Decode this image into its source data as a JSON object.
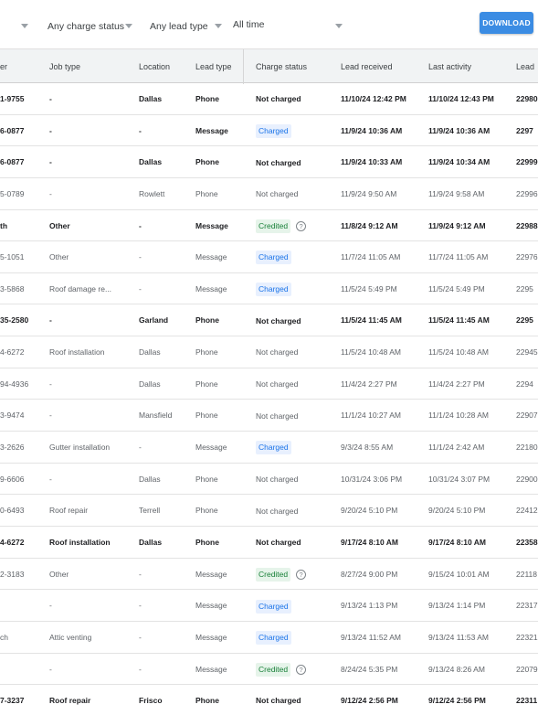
{
  "filters": {
    "charge_status": "Any charge status",
    "lead_type": "Any lead type",
    "time_range": "All time"
  },
  "download_label": "DOWNLOAD",
  "columns": [
    "er",
    "Job type",
    "Location",
    "Lead type",
    "Charge status",
    "Lead received",
    "Last activity",
    "Lead"
  ],
  "rows": [
    {
      "phone": "1-9755",
      "job": "-",
      "loc": "Dallas",
      "type": "Phone",
      "status": "Not charged",
      "received": "11/10/24 12:42 PM",
      "activity": "11/10/24 12:43 PM",
      "lead": "22980",
      "bold": true,
      "status_kind": "none"
    },
    {
      "phone": "6-0877",
      "job": "-",
      "loc": "-",
      "type": "Message",
      "status": "Charged",
      "received": "11/9/24 10:36 AM",
      "activity": "11/9/24 10:36 AM",
      "lead": "2297",
      "bold": true,
      "status_kind": "charged"
    },
    {
      "phone": "6-0877",
      "job": "-",
      "loc": "Dallas",
      "type": "Phone",
      "status": "Not charged",
      "received": "11/9/24 10:33 AM",
      "activity": "11/9/24 10:34 AM",
      "lead": "22999",
      "bold": true,
      "status_kind": "none"
    },
    {
      "phone": "5-0789",
      "job": "-",
      "loc": "Rowlett",
      "type": "Phone",
      "status": "Not charged",
      "received": "11/9/24 9:50 AM",
      "activity": "11/9/24 9:58 AM",
      "lead": "22996",
      "bold": false,
      "status_kind": "none"
    },
    {
      "phone": "th",
      "job": "Other",
      "loc": "-",
      "type": "Message",
      "status": "Credited",
      "received": "11/8/24 9:12 AM",
      "activity": "11/9/24 9:12 AM",
      "lead": "22988",
      "bold": true,
      "status_kind": "credited",
      "help": true
    },
    {
      "phone": "5-1051",
      "job": "Other",
      "loc": "-",
      "type": "Message",
      "status": "Charged",
      "received": "11/7/24 11:05 AM",
      "activity": "11/7/24 11:05 AM",
      "lead": "22976",
      "bold": false,
      "status_kind": "charged"
    },
    {
      "phone": "3-5868",
      "job": "Roof damage re...",
      "loc": "-",
      "type": "Message",
      "status": "Charged",
      "received": "11/5/24 5:49 PM",
      "activity": "11/5/24 5:49 PM",
      "lead": "2295",
      "bold": false,
      "status_kind": "charged"
    },
    {
      "phone": "35-2580",
      "job": "-",
      "loc": "Garland",
      "type": "Phone",
      "status": "Not charged",
      "received": "11/5/24 11:45 AM",
      "activity": "11/5/24 11:45 AM",
      "lead": "2295",
      "bold": true,
      "status_kind": "none"
    },
    {
      "phone": "4-6272",
      "job": "Roof installation",
      "loc": "Dallas",
      "type": "Phone",
      "status": "Not charged",
      "received": "11/5/24 10:48 AM",
      "activity": "11/5/24 10:48 AM",
      "lead": "22945",
      "bold": false,
      "status_kind": "none"
    },
    {
      "phone": "94-4936",
      "job": "-",
      "loc": "Dallas",
      "type": "Phone",
      "status": "Not charged",
      "received": "11/4/24 2:27 PM",
      "activity": "11/4/24 2:27 PM",
      "lead": "2294",
      "bold": false,
      "status_kind": "none"
    },
    {
      "phone": "3-9474",
      "job": "-",
      "loc": "Mansfield",
      "type": "Phone",
      "status": "Not charged",
      "received": "11/1/24 10:27 AM",
      "activity": "11/1/24 10:28 AM",
      "lead": "22907",
      "bold": false,
      "status_kind": "none"
    },
    {
      "phone": "3-2626",
      "job": "Gutter installation",
      "loc": "-",
      "type": "Message",
      "status": "Charged",
      "received": "9/3/24 8:55 AM",
      "activity": "11/1/24 2:42 AM",
      "lead": "22180",
      "bold": false,
      "status_kind": "charged"
    },
    {
      "phone": "9-6606",
      "job": "-",
      "loc": "Dallas",
      "type": "Phone",
      "status": "Not charged",
      "received": "10/31/24 3:06 PM",
      "activity": "10/31/24 3:07 PM",
      "lead": "22900",
      "bold": false,
      "status_kind": "none"
    },
    {
      "phone": "0-6493",
      "job": "Roof repair",
      "loc": "Terrell",
      "type": "Phone",
      "status": "Not charged",
      "received": "9/20/24 5:10 PM",
      "activity": "9/20/24 5:10 PM",
      "lead": "22412",
      "bold": false,
      "status_kind": "none"
    },
    {
      "phone": "4-6272",
      "job": "Roof installation",
      "loc": "Dallas",
      "type": "Phone",
      "status": "Not charged",
      "received": "9/17/24 8:10 AM",
      "activity": "9/17/24 8:10 AM",
      "lead": "22358",
      "bold": true,
      "status_kind": "none"
    },
    {
      "phone": "2-3183",
      "job": "Other",
      "loc": "-",
      "type": "Message",
      "status": "Credited",
      "received": "8/27/24 9:00 PM",
      "activity": "9/15/24 10:01 AM",
      "lead": "22118",
      "bold": false,
      "status_kind": "credited",
      "help": true
    },
    {
      "phone": "",
      "job": "-",
      "loc": "-",
      "type": "Message",
      "status": "Charged",
      "received": "9/13/24 1:13 PM",
      "activity": "9/13/24 1:14 PM",
      "lead": "22317",
      "bold": false,
      "status_kind": "charged"
    },
    {
      "phone": "ch",
      "job": "Attic venting",
      "loc": "-",
      "type": "Message",
      "status": "Charged",
      "received": "9/13/24 11:52 AM",
      "activity": "9/13/24 11:53 AM",
      "lead": "22321",
      "bold": false,
      "status_kind": "charged"
    },
    {
      "phone": "",
      "job": "-",
      "loc": "-",
      "type": "Message",
      "status": "Credited",
      "received": "8/24/24 5:35 PM",
      "activity": "9/13/24 8:26 AM",
      "lead": "22079",
      "bold": false,
      "status_kind": "credited",
      "help": true
    },
    {
      "phone": "7-3237",
      "job": "Roof repair",
      "loc": "Frisco",
      "type": "Phone",
      "status": "Not charged",
      "received": "9/12/24 2:56 PM",
      "activity": "9/12/24 2:56 PM",
      "lead": "22311",
      "bold": true,
      "status_kind": "none"
    }
  ],
  "icons": {
    "help": "question-circle-icon",
    "dropdown": "triangle-down-icon"
  },
  "colors": {
    "download_bg": "#3b8ce3",
    "charged_bg": "#e8f0fe",
    "charged_fg": "#1a73e8",
    "credited_bg": "#e6f4ea",
    "credited_fg": "#188038"
  }
}
